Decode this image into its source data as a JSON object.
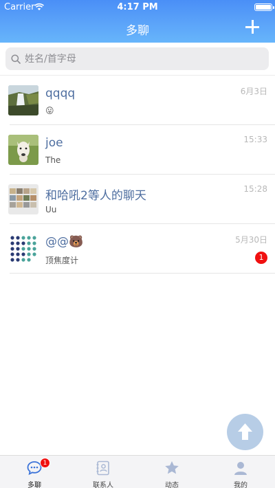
{
  "status_bar": {
    "carrier": "Carrier",
    "time": "4:17 PM"
  },
  "header": {
    "title": "多聊",
    "add_icon": "plus-icon"
  },
  "search": {
    "placeholder": "姓名/首字母"
  },
  "chats": [
    {
      "name": "qqqq",
      "preview": "😛",
      "time": "6月3日",
      "avatar": "waterfall-photo"
    },
    {
      "name": "joe",
      "preview": "The",
      "time": "15:33",
      "avatar": "alpaca-photo"
    },
    {
      "name": "和哈吼2等人的聊天",
      "preview": "Uu",
      "time": "15:28",
      "avatar": "group-photo-grid"
    },
    {
      "name": "@@🐻",
      "preview": "顶焦度计",
      "time": "5月30日",
      "avatar": "dot-pattern",
      "unread": "1"
    }
  ],
  "tabs": [
    {
      "label": "多聊",
      "icon": "chat-bubble-icon",
      "badge": "1",
      "active": true
    },
    {
      "label": "联系人",
      "icon": "contacts-book-icon"
    },
    {
      "label": "动态",
      "icon": "star-icon"
    },
    {
      "label": "我的",
      "icon": "person-icon"
    }
  ],
  "colors": {
    "header_top": "#4a8ff7",
    "header_bottom": "#67b5fb",
    "name": "#4e6ea0",
    "badge": "#f01010",
    "tab_icon": "#aab8d4"
  }
}
